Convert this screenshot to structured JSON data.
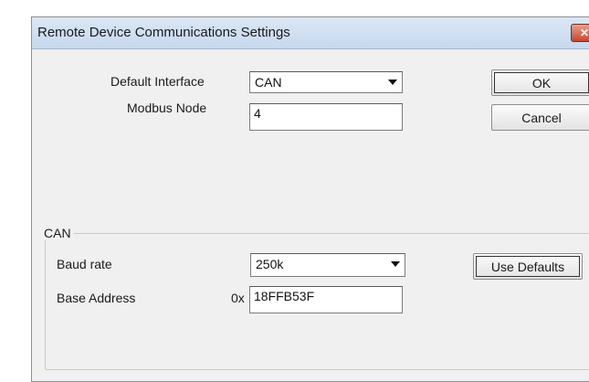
{
  "window": {
    "title": "Remote Device Communications Settings",
    "close_glyph": "✕"
  },
  "default_interface": {
    "label": "Default Interface",
    "value": "CAN"
  },
  "modbus_node": {
    "label": "Modbus Node",
    "value": "4"
  },
  "buttons": {
    "ok": "OK",
    "cancel": "Cancel",
    "use_defaults": "Use Defaults"
  },
  "can_group": {
    "title": "CAN",
    "baud_rate": {
      "label": "Baud rate",
      "value": "250k"
    },
    "base_address": {
      "label": "Base Address",
      "prefix": "0x",
      "value": "18FFB53F"
    }
  },
  "icons": {
    "dropdown": "chevron-down-icon",
    "close": "close-icon"
  }
}
